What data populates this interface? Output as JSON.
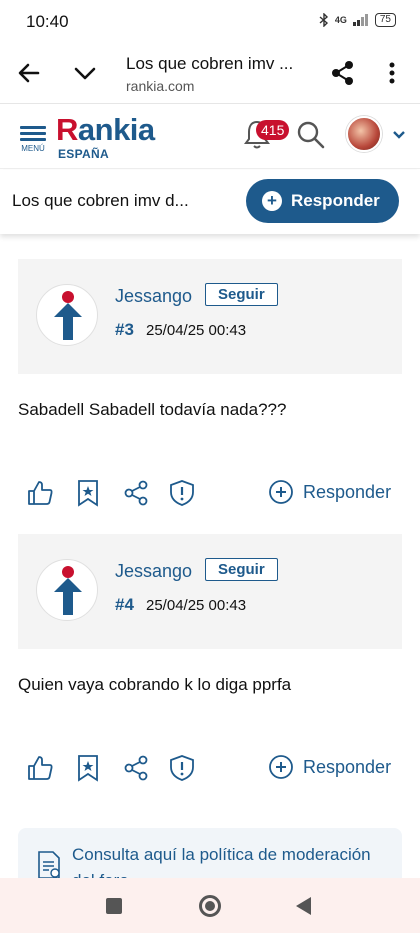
{
  "status_bar": {
    "time": "10:40",
    "network": "4G",
    "battery": "75"
  },
  "browser": {
    "page_title": "Los que cobren imv ...",
    "url": "rankia.com"
  },
  "header": {
    "menu_label": "MENÚ",
    "logo_text_r": "R",
    "logo_text_rest": "ankia",
    "logo_sub": "ESPAÑA",
    "notifications_count": "415"
  },
  "topic_bar": {
    "topic_title": "Los que cobren imv d...",
    "reply_label": "Responder"
  },
  "posts": [
    {
      "username": "Jessango",
      "follow_label": "Seguir",
      "number": "#3",
      "date": "25/04/25 00:43",
      "text": "Sabadell Sabadell todavía nada???",
      "reply_label": "Responder"
    },
    {
      "username": "Jessango",
      "follow_label": "Seguir",
      "number": "#4",
      "date": "25/04/25 00:43",
      "text": "Quien vaya cobrando k lo diga pprfa",
      "reply_label": "Responder"
    }
  ],
  "policy": {
    "text": "Consulta aquí la política de moderación del foro"
  },
  "colors": {
    "brand": "#1e5a8c",
    "accent_red": "#c8102e",
    "post_bg": "#f4f4f4"
  }
}
